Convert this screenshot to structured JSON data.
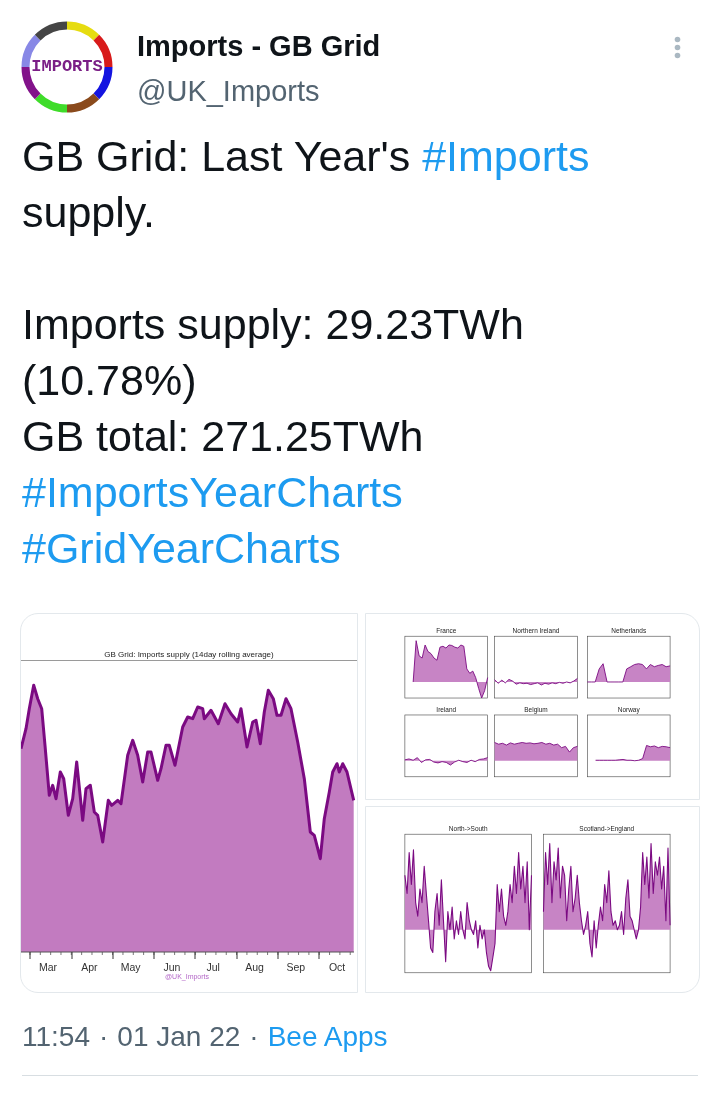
{
  "author": {
    "avatar_text": "IMPORTS",
    "name": "Imports - GB Grid",
    "handle": "@UK_Imports"
  },
  "body": {
    "paragraphs": [
      {
        "lines": [
          {
            "parts": [
              {
                "kind": "text",
                "text": "GB Grid: Last Year's "
              },
              {
                "kind": "hashtag",
                "text": "#Imports"
              },
              {
                "kind": "text",
                "text": " supply."
              }
            ]
          }
        ]
      },
      {
        "lines": [
          {
            "parts": [
              {
                "kind": "text",
                "text": "Imports supply: 29.23TWh (10.78%)"
              }
            ]
          },
          {
            "parts": [
              {
                "kind": "text",
                "text": "GB total: 271.25TWh"
              }
            ]
          },
          {
            "parts": [
              {
                "kind": "hashtag",
                "text": "#ImportsYearCharts"
              }
            ]
          },
          {
            "parts": [
              {
                "kind": "hashtag",
                "text": "#GridYearCharts"
              }
            ]
          }
        ]
      }
    ]
  },
  "media": [
    {
      "kind": "area_chart",
      "title": "GB Grid: Imports supply (14day rolling average)",
      "x_labels": [
        "Mar",
        "Apr",
        "May",
        "Jun",
        "Jul",
        "Aug",
        "Sep",
        "Oct"
      ],
      "credit": "@UK_Imports"
    },
    {
      "kind": "panel_grid",
      "panels": [
        {
          "title": "France"
        },
        {
          "title": "Northern Ireland"
        },
        {
          "title": "Netherlands"
        },
        {
          "title": "Ireland"
        },
        {
          "title": "Belgium"
        },
        {
          "title": "Norway"
        }
      ]
    },
    {
      "kind": "panel_grid",
      "panels": [
        {
          "title": "North->South"
        },
        {
          "title": "Scotland->England"
        }
      ]
    }
  ],
  "meta": [
    {
      "kind": "time",
      "text": "11:54"
    },
    {
      "kind": "separator",
      "text": "·"
    },
    {
      "kind": "date",
      "text": "01 Jan 22"
    },
    {
      "kind": "separator",
      "text": "·"
    },
    {
      "kind": "source",
      "text": "Bee Apps"
    }
  ]
}
